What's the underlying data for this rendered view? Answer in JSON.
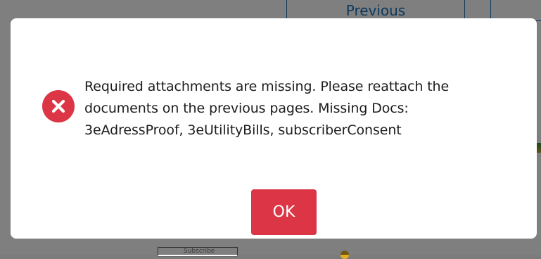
{
  "background": {
    "previous_label": "Previous",
    "bottom_box_label": "Subscribe"
  },
  "dialog": {
    "icon": "error-circle-x-icon",
    "message_lines": [
      "Required attachments are missing. Please reattach the",
      "documents on the previous pages. Missing Docs:",
      "3eAdressProof, 3eUtilityBills, subscriberConsent"
    ],
    "ok_label": "OK"
  },
  "colors": {
    "error": "#dc3545",
    "link": "#1a73b8",
    "text": "#1c1c1c"
  }
}
